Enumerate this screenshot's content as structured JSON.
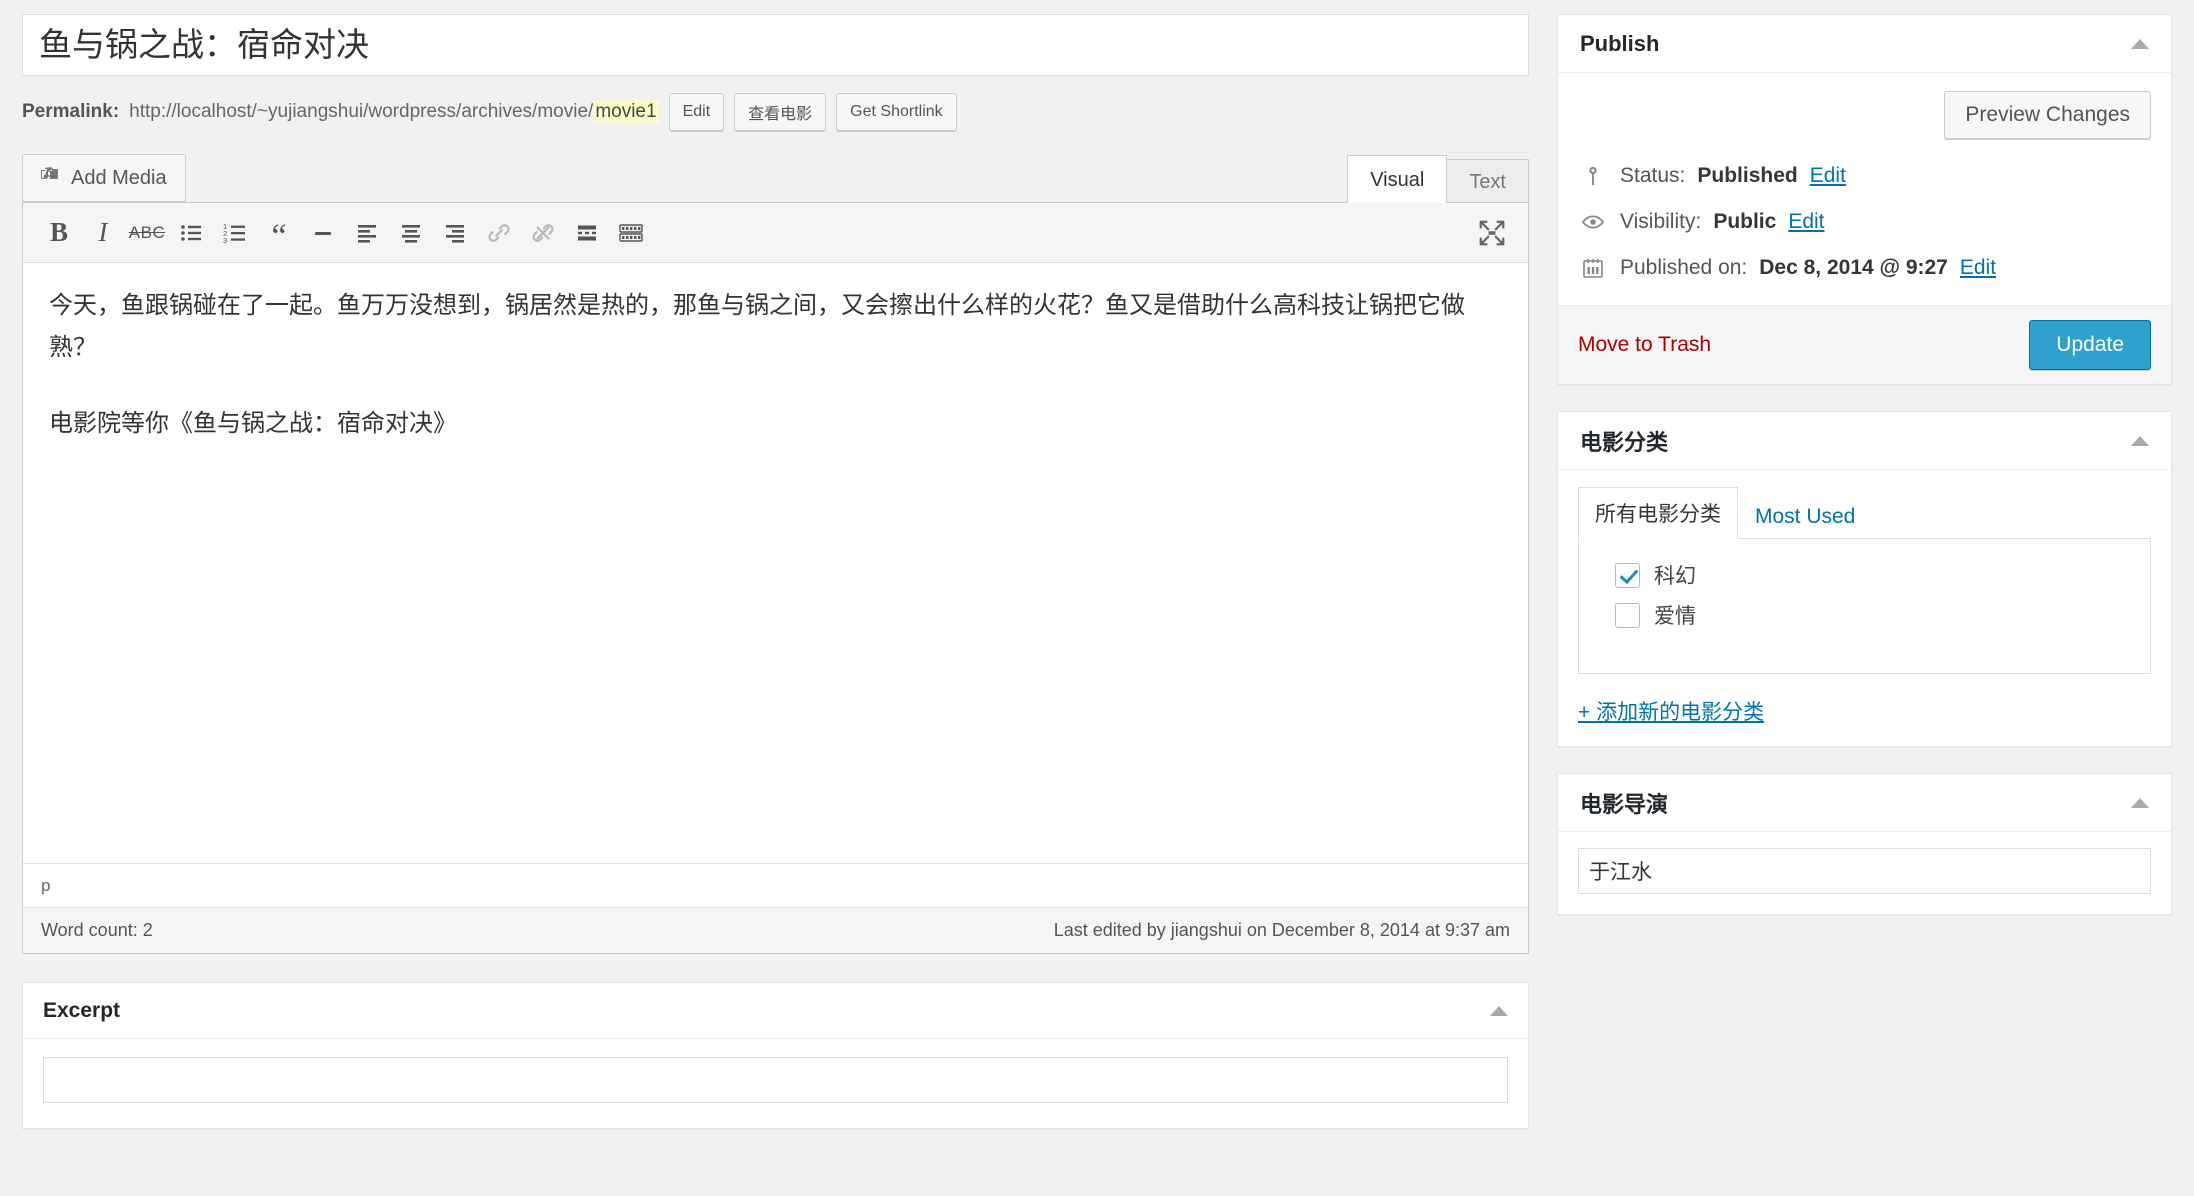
{
  "post": {
    "title": "鱼与锅之战：宿命对决",
    "permalink": {
      "label": "Permalink:",
      "url_prefix": "http://localhost/~yujiangshui/wordpress/archives/movie/",
      "slug": "movie1",
      "edit_button": "Edit",
      "view_button": "查看电影",
      "shortlink_button": "Get Shortlink"
    }
  },
  "editor": {
    "add_media_label": "Add Media",
    "tabs": [
      {
        "label": "Visual",
        "active": true
      },
      {
        "label": "Text",
        "active": false
      }
    ],
    "toolbar": [
      {
        "name": "bold",
        "glyph": "B"
      },
      {
        "name": "italic",
        "glyph": "I"
      },
      {
        "name": "strikethrough",
        "glyph": "ABC"
      },
      {
        "name": "bullet-list",
        "glyph": ""
      },
      {
        "name": "numbered-list",
        "glyph": ""
      },
      {
        "name": "blockquote",
        "glyph": "“"
      },
      {
        "name": "horizontal-rule",
        "glyph": ""
      },
      {
        "name": "align-left",
        "glyph": ""
      },
      {
        "name": "align-center",
        "glyph": ""
      },
      {
        "name": "align-right",
        "glyph": ""
      },
      {
        "name": "insert-link",
        "glyph": ""
      },
      {
        "name": "remove-link",
        "glyph": ""
      },
      {
        "name": "insert-more-tag",
        "glyph": ""
      },
      {
        "name": "toolbar-toggle",
        "glyph": ""
      }
    ],
    "fullscreen_label": "Distraction-free writing mode",
    "content": {
      "paragraph1": "今天，鱼跟锅碰在了一起。鱼万万没想到，锅居然是热的，那鱼与锅之间，又会擦出什么样的火花？鱼又是借助什么高科技让锅把它做熟？",
      "paragraph2": "电影院等你《鱼与锅之战：宿命对决》"
    },
    "path": "p",
    "word_count": "Word count: 2",
    "last_edited": "Last edited by jiangshui on December 8, 2014 at 9:37 am"
  },
  "excerpt": {
    "title": "Excerpt",
    "value": ""
  },
  "publish": {
    "title": "Publish",
    "preview_button": "Preview Changes",
    "status_label": "Status:",
    "status_value": "Published",
    "status_edit": "Edit",
    "visibility_label": "Visibility:",
    "visibility_value": "Public",
    "visibility_edit": "Edit",
    "published_label": "Published on:",
    "published_value": "Dec 8, 2014 @ 9:27",
    "published_edit": "Edit",
    "trash_label": "Move to Trash",
    "update_label": "Update",
    "accent_color": "#2ea2cc",
    "link_color": "#0073aa",
    "trash_color": "#a00"
  },
  "category_panel": {
    "title": "电影分类",
    "tabs": [
      {
        "label": "所有电影分类",
        "active": true
      },
      {
        "label": "Most Used",
        "active": false
      }
    ],
    "items": [
      {
        "label": "科幻",
        "checked": true
      },
      {
        "label": "爱情",
        "checked": false
      }
    ],
    "add_link": "+ 添加新的电影分类"
  },
  "director_panel": {
    "title": "电影导演",
    "value": "于江水"
  }
}
